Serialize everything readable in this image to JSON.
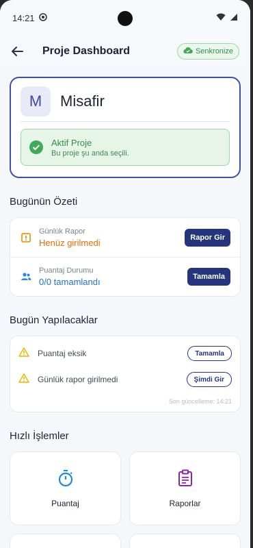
{
  "status": {
    "time": "14:21"
  },
  "appbar": {
    "title": "Proje Dashboard",
    "sync_label": "Senkronize"
  },
  "profile": {
    "avatar_letter": "M",
    "name": "Misafir",
    "active_title": "Aktif Proje",
    "active_sub": "Bu proje şu anda seçili."
  },
  "summary": {
    "title": "Bugünün Özeti",
    "rows": [
      {
        "label": "Günlük Rapor",
        "value": "Henüz girilmedi",
        "button": "Rapor Gir"
      },
      {
        "label": "Puantaj Durumu",
        "value": "0/0 tamamlandı",
        "button": "Tamamla"
      }
    ]
  },
  "todo": {
    "title": "Bugün Yapılacaklar",
    "items": [
      {
        "text": "Puantaj eksik",
        "button": "Tamamla"
      },
      {
        "text": "Günlük rapor girilmedi",
        "button": "Şimdi Gir"
      }
    ],
    "updated": "Son güncelleme: 14:21"
  },
  "quick": {
    "title": "Hızlı İşlemler",
    "tiles": [
      {
        "label": "Puantaj",
        "icon": "stopwatch-icon"
      },
      {
        "label": "Raporlar",
        "icon": "clipboard-icon"
      }
    ]
  },
  "colors": {
    "primary": "#24357e",
    "success": "#3faa57",
    "warning": "#f0a020",
    "orange": "#ef6c00",
    "info": "#1e88e5",
    "purple": "#8e24aa"
  }
}
